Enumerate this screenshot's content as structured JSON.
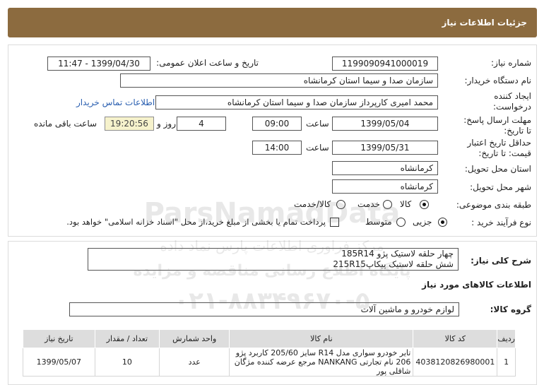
{
  "header": {
    "title": "جزئیات اطلاعات نیاز"
  },
  "form": {
    "need_number_label": "شماره نیاز:",
    "need_number": "1199090941000019",
    "announce_label": "تاریخ و ساعت اعلان عمومی:",
    "announce_value": "1399/04/30 - 11:47",
    "buyer_org_label": "نام دستگاه خریدار:",
    "buyer_org": "سازمان صدا و سیما استان کرمانشاه",
    "creator_label_1": "ایجاد کننده",
    "creator_label_2": "درخواست:",
    "creator": "محمد امیری کارپرداز سازمان صدا و سیما استان کرمانشاه",
    "buyer_contact_link": "اطلاعات تماس خریدار",
    "deadline_label_1": "مهلت ارسال پاسخ:",
    "deadline_label_2": "تا تاریخ:",
    "deadline_date": "1399/05/04",
    "time_label": "ساعت",
    "deadline_time": "09:00",
    "days_value": "4",
    "days_label": "روز و",
    "remaining_time": "19:20:56",
    "remaining_label": "ساعت باقی مانده",
    "validity_label_1": "حداقل تاریخ اعتبار",
    "validity_label_2": "قیمت: تا تاریخ:",
    "validity_date": "1399/05/31",
    "validity_time_label": "ساعت",
    "validity_time": "14:00",
    "province_label": "استان محل تحویل:",
    "province": "کرمانشاه",
    "city_label": "شهر محل تحویل:",
    "city": "کرمانشاه",
    "category_label": "طبقه بندی موضوعی:",
    "category_options": [
      "کالا",
      "خدمت",
      "کالا/خدمت"
    ],
    "category_selected": "کالا",
    "process_label": "نوع فرآیند خرید :",
    "process_options": [
      "جزیی",
      "متوسط"
    ],
    "process_selected": "جزیی",
    "payment_note": "پرداخت تمام یا بخشی از مبلغ خرید،از محل \"اسناد خزانه اسلامی\" خواهد بود."
  },
  "watermark": {
    "brand": "ParsNamadData",
    "line1": "مرکز فراوری اطلاعات پارس نماد داده",
    "line2": "پایگاه اطلاع رسانی مناقصه و مزایده",
    "phone": "۰۲۱-۸۸۳۴۹۶۷۰-۵"
  },
  "need_summary": {
    "label": "شرح کلی نیاز:",
    "line1": "چهار حلقه لاستیک پژو 185R14",
    "line2": "شش حلقه لاستیک پیکاپ215R15"
  },
  "goods": {
    "section_title": "اطلاعات کالاهای مورد نیاز",
    "group_label": "گروه کالا:",
    "group_value": "لوازم خودرو و ماشین آلات",
    "columns": [
      "ردیف",
      "کد کالا",
      "نام کالا",
      "واحد شمارش",
      "تعداد / مقدار",
      "تاریخ نیاز"
    ],
    "rows": [
      {
        "row": "1",
        "code": "4038120826980001",
        "name": "تایر خودرو سواری مدل R14 سایز 205/60 کاربرد پژو 206 نام تجارتی NANKANG مرجع عرضه کننده مژگان شاقلی پور",
        "unit": "عدد",
        "qty": "10",
        "date": "1399/05/07"
      }
    ]
  }
}
